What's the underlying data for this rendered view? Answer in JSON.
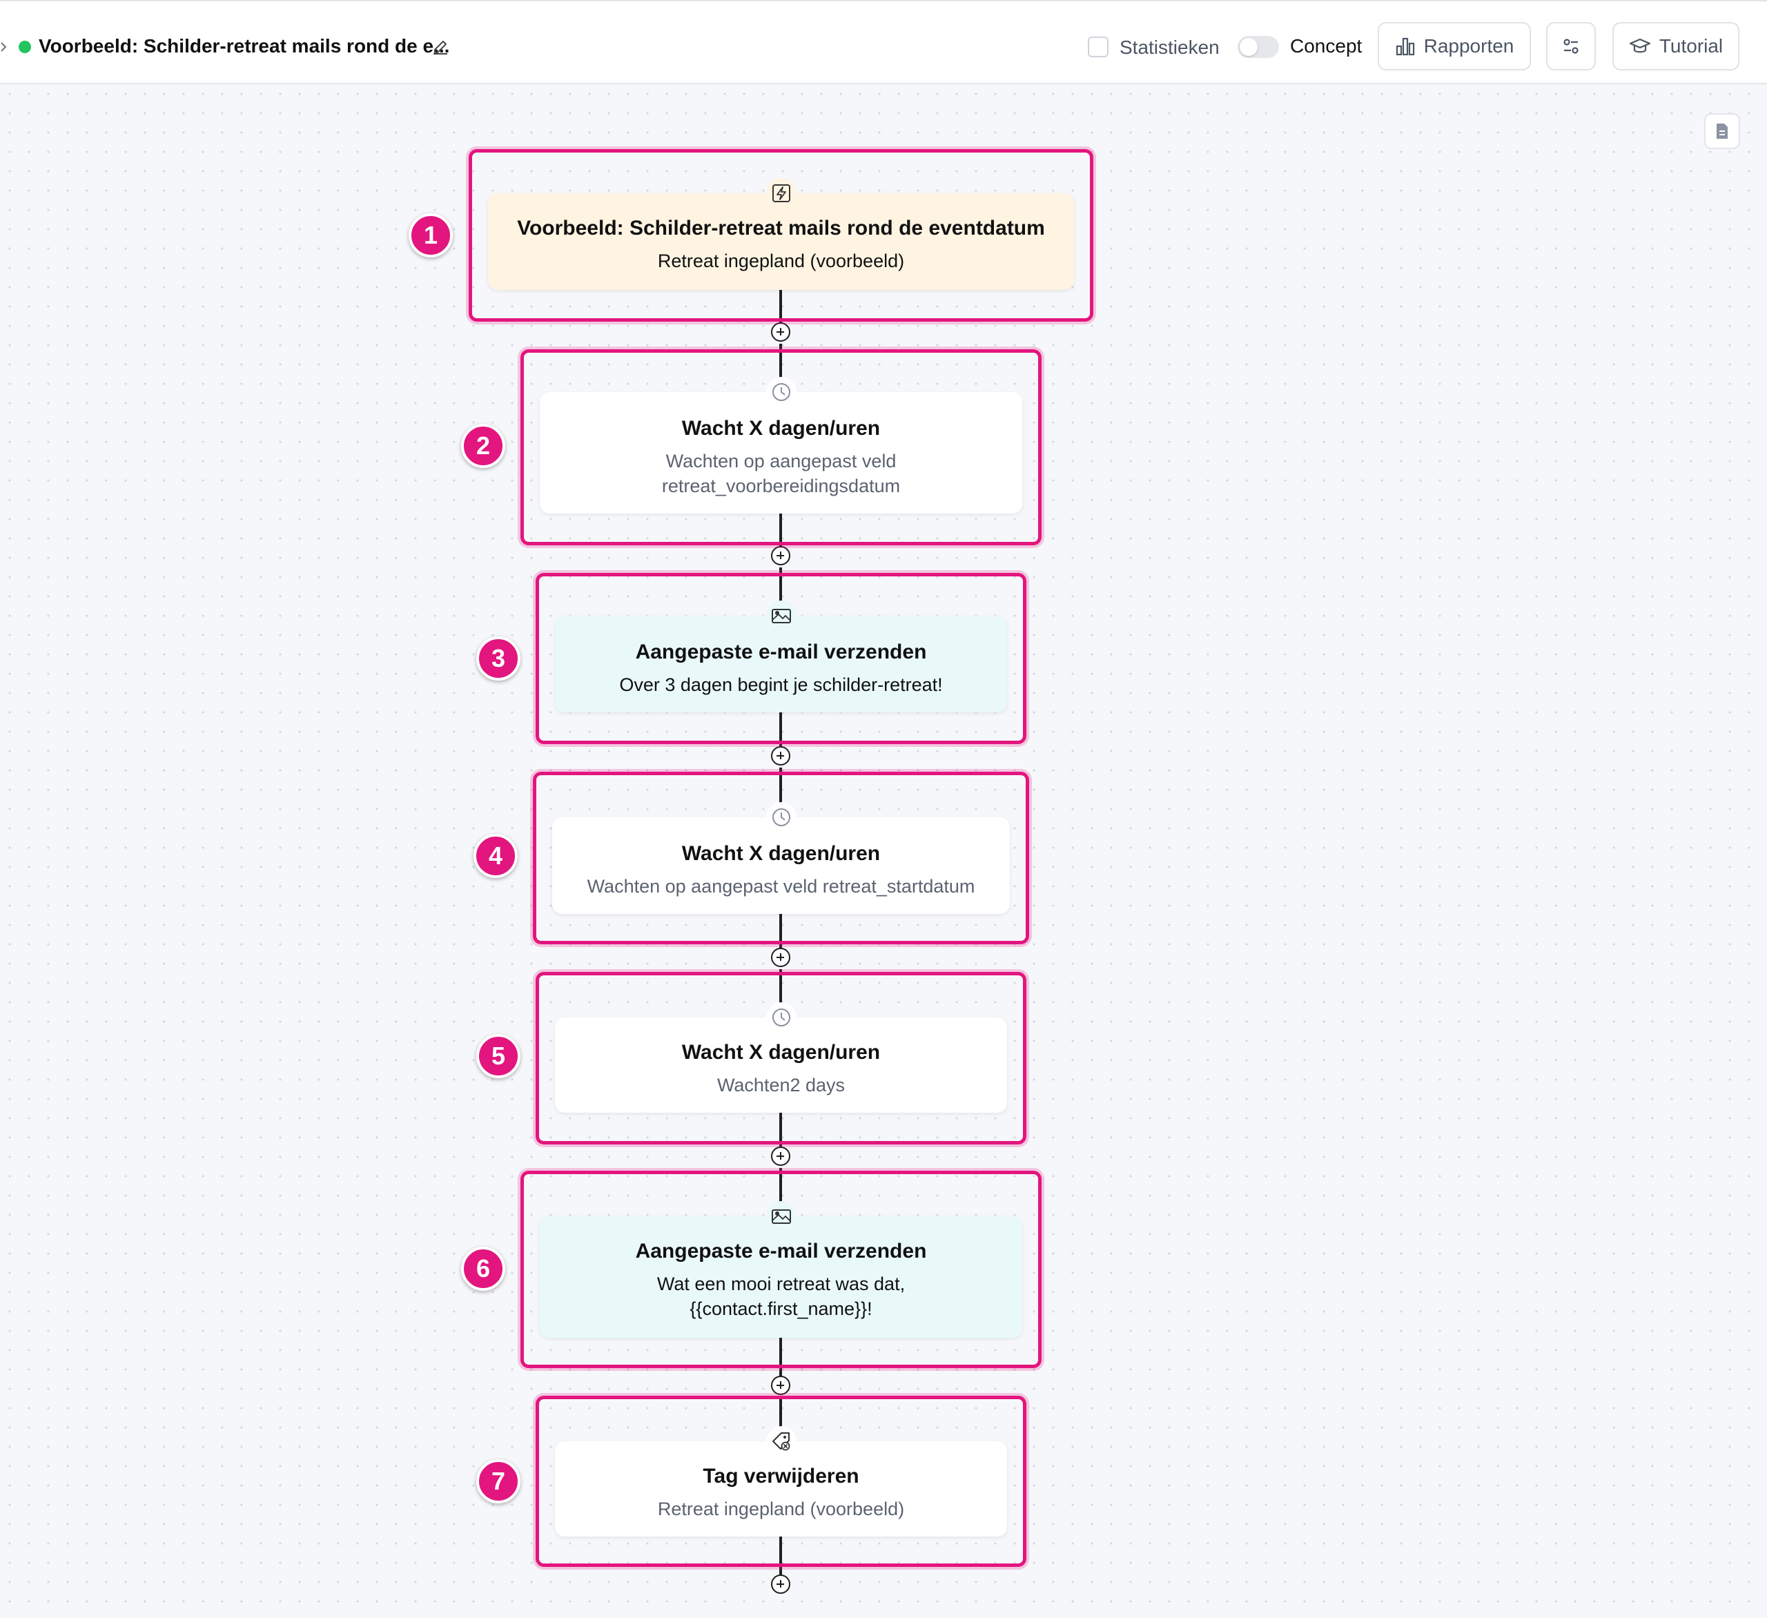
{
  "header": {
    "title": "Voorbeeld: Schilder-retreat mails rond de e...",
    "statistics_label": "Statistieken",
    "concept_label": "Concept",
    "reports_label": "Rapporten",
    "tutorial_label": "Tutorial",
    "status_color": "#22c55e"
  },
  "highlight_color": "#e3157e",
  "steps": [
    {
      "number": "1",
      "type": "trigger",
      "icon": "lightning-icon",
      "title": "Voorbeeld: Schilder-retreat mails rond de eventdatum",
      "subtitle": [
        "Retreat ingepland (voorbeeld)"
      ]
    },
    {
      "number": "2",
      "type": "wait",
      "icon": "clock-icon",
      "title": "Wacht X dagen/uren",
      "subtitle": [
        "Wachten op aangepast veld",
        "retreat_voorbereidingsdatum"
      ]
    },
    {
      "number": "3",
      "type": "email",
      "icon": "email-image-icon",
      "title": "Aangepaste e-mail verzenden",
      "subtitle": [
        "Over 3 dagen begint je schilder-retreat!"
      ]
    },
    {
      "number": "4",
      "type": "wait",
      "icon": "clock-icon",
      "title": "Wacht X dagen/uren",
      "subtitle": [
        "Wachten op aangepast veld retreat_startdatum"
      ]
    },
    {
      "number": "5",
      "type": "wait",
      "icon": "clock-icon",
      "title": "Wacht X dagen/uren",
      "subtitle": [
        "Wachten2 days"
      ]
    },
    {
      "number": "6",
      "type": "email",
      "icon": "email-image-icon",
      "title": "Aangepaste e-mail verzenden",
      "subtitle": [
        "Wat een mooi retreat was dat,",
        "{{contact.first_name}}!"
      ]
    },
    {
      "number": "7",
      "type": "tag",
      "icon": "tag-remove-icon",
      "title": "Tag verwijderen",
      "subtitle": [
        "Retreat ingepland (voorbeeld)"
      ]
    }
  ]
}
